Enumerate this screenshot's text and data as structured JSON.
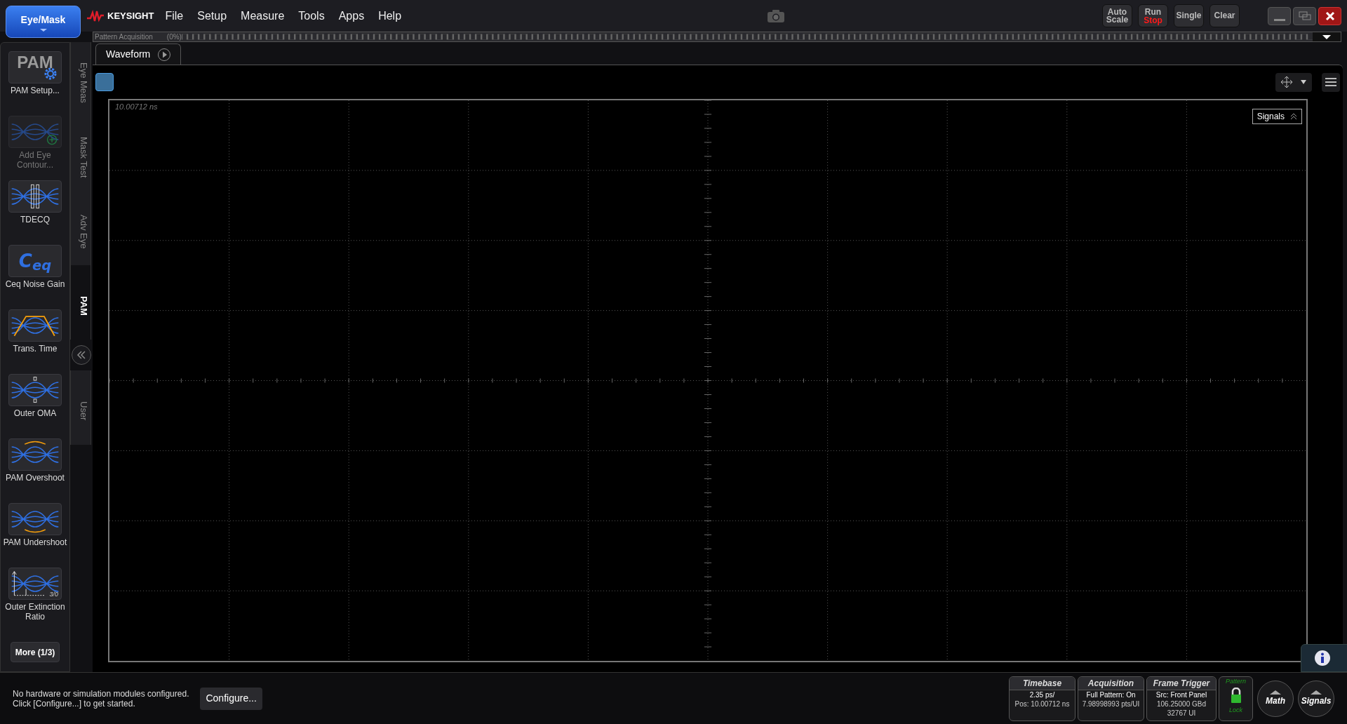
{
  "mode_button": {
    "label": "Eye/Mask"
  },
  "brand": "KEYSIGHT",
  "menu": [
    "File",
    "Setup",
    "Measure",
    "Tools",
    "Apps",
    "Help"
  ],
  "run_controls": [
    {
      "kind": "plain",
      "label": "Auto Scale"
    },
    {
      "kind": "runstop",
      "label": "Run",
      "sublabel": "Stop"
    },
    {
      "kind": "plain",
      "label": "Single"
    },
    {
      "kind": "plain",
      "label": "Clear"
    }
  ],
  "progress": {
    "label": "Pattern Acquisition",
    "percent": "(0%)"
  },
  "sidebar": {
    "items": [
      {
        "kind": "pam",
        "label": "PAM Setup...",
        "icon_text": "PAM",
        "disabled": false
      },
      {
        "kind": "contour",
        "label": "Add Eye Contour...",
        "disabled": true
      },
      {
        "kind": "tdecq",
        "label": "TDECQ",
        "disabled": false
      },
      {
        "kind": "ceq",
        "label": "Ceq Noise Gain",
        "icon_text": "C$_{eq}$",
        "disabled": false
      },
      {
        "kind": "trans",
        "label": "Trans. Time",
        "disabled": false
      },
      {
        "kind": "oma",
        "label": "Outer OMA",
        "disabled": false
      },
      {
        "kind": "overshoot",
        "label": "PAM Overshoot",
        "disabled": false
      },
      {
        "kind": "undershoot",
        "label": "PAM Undershoot",
        "disabled": false
      },
      {
        "kind": "extinction",
        "label": "Outer Extinction Ratio",
        "icon_text": "3/0",
        "disabled": false
      }
    ],
    "more_button": "More (1/3)"
  },
  "side_tabs": [
    {
      "label": "Eye Meas",
      "selected": false
    },
    {
      "label": "Mask Test",
      "selected": false
    },
    {
      "label": "Adv Eye",
      "selected": false
    },
    {
      "label": "PAM",
      "selected": true
    },
    {
      "label": "User",
      "selected": false
    }
  ],
  "waveform_tab": {
    "label": "Waveform"
  },
  "plot": {
    "time_label": "10.00712 ns",
    "signals_button": "Signals"
  },
  "status": {
    "message": [
      "No hardware or simulation modules configured.",
      "Click [Configure...] to get started."
    ],
    "configure_button": "Configure..."
  },
  "panels": [
    {
      "title": "Timebase",
      "lines": [
        "2.35 ps/",
        "Pos: 10.00712 ns"
      ]
    },
    {
      "title": "Acquisition",
      "lines": [
        "Full Pattern: On",
        "7.98998993 pts/UI"
      ]
    },
    {
      "title": "Frame Trigger",
      "lines": [
        "Src: Front Panel",
        "106.25000 GBd",
        "32767 UI"
      ]
    }
  ],
  "lock": {
    "top": "Pattern",
    "bottom": "Lock"
  },
  "round_buttons": [
    "Math",
    "Signals"
  ]
}
